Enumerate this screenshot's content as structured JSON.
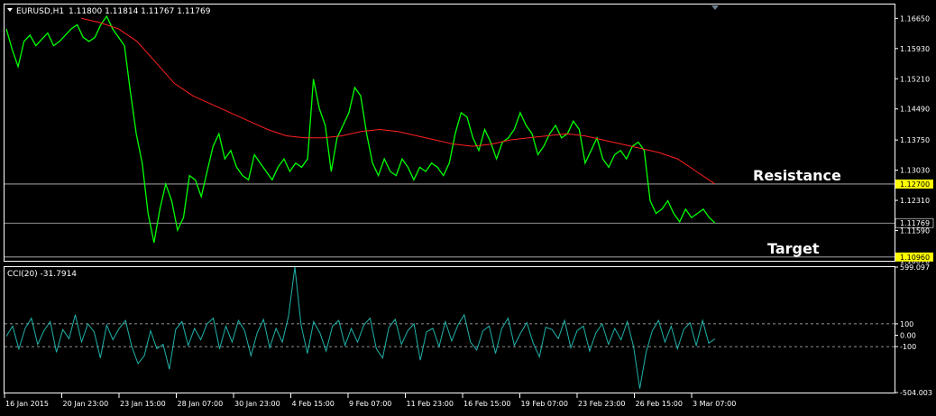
{
  "chart_header": {
    "symbol": "EURUSD,H1",
    "ohlc": "1.11800 1.11814 1.11767 1.11769"
  },
  "cci_header": "CCI(20) -31.7914",
  "colors": {
    "background": "#000000",
    "frame": "#ffffff",
    "price": "#00ff00",
    "ma": "#ff2020",
    "cci": "#20b2aa",
    "level_box": "#ffff00"
  },
  "annotations": {
    "resistance": "Resistance",
    "target": "Target"
  },
  "chart_data": [
    {
      "type": "line",
      "title": "EURUSD,H1",
      "x_labels": [
        "16 Jan 2015",
        "20 Jan 23:00",
        "23 Jan 15:00",
        "28 Jan 07:00",
        "30 Jan 23:00",
        "4 Feb 15:00",
        "9 Feb 07:00",
        "11 Feb 23:00",
        "16 Feb 15:00",
        "19 Feb 07:00",
        "23 Feb 23:00",
        "26 Feb 15:00",
        "3 Mar 07:00"
      ],
      "y_ticks": [
        "1.16650",
        "1.15930",
        "1.15210",
        "1.14490",
        "1.13750",
        "1.13030",
        "1.12310",
        "1.11590",
        "1.10870"
      ],
      "ylim": [
        1.1087,
        1.1698
      ],
      "series": [
        {
          "name": "EURUSD,H1",
          "kind": "price",
          "values": [
            1.164,
            1.159,
            1.155,
            1.161,
            1.1625,
            1.16,
            1.1615,
            1.163,
            1.16,
            1.161,
            1.1625,
            1.164,
            1.165,
            1.162,
            1.161,
            1.162,
            1.165,
            1.167,
            1.164,
            1.162,
            1.16,
            1.149,
            1.139,
            1.132,
            1.12,
            1.113,
            1.121,
            1.127,
            1.123,
            1.116,
            1.119,
            1.129,
            1.128,
            1.124,
            1.13,
            1.136,
            1.139,
            1.133,
            1.135,
            1.131,
            1.129,
            1.128,
            1.134,
            1.132,
            1.13,
            1.128,
            1.131,
            1.133,
            1.13,
            1.132,
            1.131,
            1.133,
            1.152,
            1.145,
            1.141,
            1.13,
            1.138,
            1.141,
            1.144,
            1.15,
            1.148,
            1.139,
            1.132,
            1.129,
            1.133,
            1.13,
            1.129,
            1.133,
            1.131,
            1.128,
            1.131,
            1.13,
            1.132,
            1.131,
            1.129,
            1.132,
            1.139,
            1.144,
            1.143,
            1.138,
            1.135,
            1.14,
            1.137,
            1.133,
            1.137,
            1.138,
            1.14,
            1.144,
            1.141,
            1.139,
            1.134,
            1.136,
            1.139,
            1.141,
            1.138,
            1.139,
            1.142,
            1.14,
            1.132,
            1.135,
            1.138,
            1.133,
            1.131,
            1.134,
            1.135,
            1.133,
            1.136,
            1.137,
            1.135,
            1.123,
            1.12,
            1.121,
            1.123,
            1.12,
            1.118,
            1.121,
            1.119,
            1.12,
            1.121,
            1.119,
            1.1177
          ]
        },
        {
          "name": "Moving Average",
          "kind": "ma",
          "values": [
            1.1665,
            1.1655,
            1.164,
            1.161,
            1.156,
            1.151,
            1.148,
            1.146,
            1.144,
            1.142,
            1.14,
            1.1385,
            1.138,
            1.138,
            1.1385,
            1.1395,
            1.14,
            1.1395,
            1.1385,
            1.1375,
            1.1365,
            1.136,
            1.1365,
            1.1375,
            1.138,
            1.1385,
            1.139,
            1.1385,
            1.1375,
            1.1365,
            1.1355,
            1.1345,
            1.133,
            1.13,
            1.127
          ]
        }
      ],
      "levels": [
        {
          "label": "1.12700",
          "value": 1.127,
          "boxed": true
        },
        {
          "label": "1.11769",
          "value": 1.11769,
          "boxed": false
        },
        {
          "label": "1.10960",
          "value": 1.1096,
          "boxed": true
        }
      ]
    },
    {
      "type": "line",
      "title": "CCI(20) -31.7914",
      "y_ticks": [
        "599.097",
        "100",
        "0.00",
        "-100",
        "-504.003"
      ],
      "ylim": [
        -504.003,
        599.097
      ],
      "levels": [
        100,
        -100
      ],
      "series": [
        {
          "name": "CCI(20)",
          "values": [
            -10,
            80,
            -120,
            60,
            150,
            -80,
            40,
            120,
            -150,
            50,
            -30,
            180,
            -60,
            100,
            30,
            -200,
            90,
            -40,
            60,
            130,
            -100,
            -250,
            -180,
            40,
            -120,
            -80,
            -300,
            50,
            120,
            -90,
            60,
            -40,
            100,
            150,
            -120,
            80,
            -60,
            130,
            40,
            -180,
            20,
            140,
            -110,
            60,
            -60,
            170,
            600,
            90,
            -160,
            120,
            20,
            -140,
            80,
            130,
            -90,
            60,
            -60,
            90,
            150,
            -120,
            -200,
            70,
            140,
            -80,
            40,
            100,
            -220,
            30,
            60,
            -100,
            120,
            -50,
            90,
            180,
            -60,
            -130,
            40,
            80,
            -160,
            60,
            150,
            -90,
            20,
            110,
            -70,
            -190,
            70,
            50,
            -30,
            130,
            -110,
            40,
            80,
            -140,
            20,
            100,
            -80,
            60,
            -40,
            120,
            -100,
            -470,
            -150,
            40,
            130,
            -60,
            80,
            -120,
            50,
            110,
            -90,
            130,
            -70,
            -31.79
          ]
        }
      ]
    }
  ]
}
